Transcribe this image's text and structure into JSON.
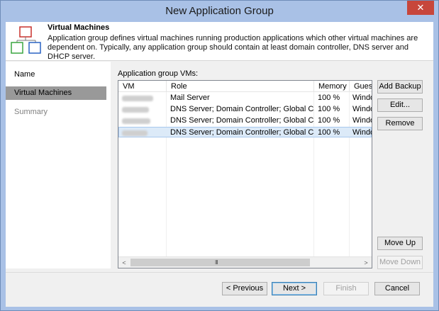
{
  "window": {
    "title": "New Application Group",
    "close_glyph": "✕"
  },
  "header": {
    "icon": "application-group-icon",
    "title": "Virtual Machines",
    "description": "Application group defines virtual machines running production applications which other virtual machines are dependent on. Typically, any application group should contain at least domain controller, DNS server and DHCP server."
  },
  "nav": {
    "items": [
      {
        "label": "Name",
        "state": "normal"
      },
      {
        "label": "Virtual Machines",
        "state": "active"
      },
      {
        "label": "Summary",
        "state": "disabled"
      }
    ]
  },
  "vms": {
    "label": "Application group VMs:",
    "columns": [
      "VM",
      "Role",
      "Memory",
      "Guest"
    ],
    "rows": [
      {
        "vm": "",
        "role": "Mail Server",
        "memory": "100 %",
        "guest": "Windo",
        "selected": false
      },
      {
        "vm": "",
        "role": "DNS Server; Domain Controller; Global Catalog",
        "memory": "100 %",
        "guest": "Windo",
        "selected": false
      },
      {
        "vm": "",
        "role": "DNS Server; Domain Controller; Global Catalog",
        "memory": "100 %",
        "guest": "Windo",
        "selected": false
      },
      {
        "vm": "",
        "role": "DNS Server; Domain Controller; Global Catalog",
        "memory": "100 %",
        "guest": "Windo",
        "selected": true
      }
    ],
    "scroll_left_glyph": "<",
    "scroll_right_glyph": ">",
    "scroll_grip_glyph": "III"
  },
  "side_buttons": {
    "add_backup": "Add Backup",
    "edit": "Edit...",
    "remove": "Remove",
    "move_up": "Move Up",
    "move_down": "Move Down"
  },
  "footer": {
    "previous": "< Previous",
    "next": "Next >",
    "finish": "Finish",
    "cancel": "Cancel"
  }
}
